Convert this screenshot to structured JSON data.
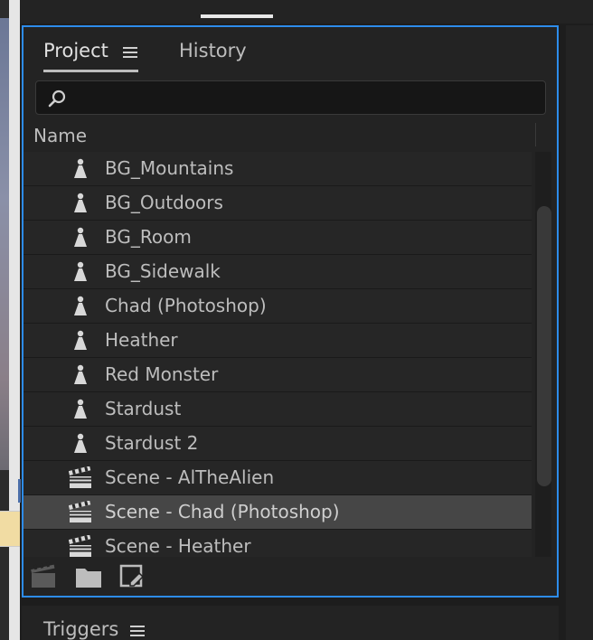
{
  "tabs": {
    "project_label": "Project",
    "history_label": "History"
  },
  "search": {
    "placeholder": "",
    "value": ""
  },
  "columns": {
    "name": "Name"
  },
  "items": [
    {
      "label": "BG_Mountains",
      "icon": "puppet-icon",
      "selected": false
    },
    {
      "label": "BG_Outdoors",
      "icon": "puppet-icon",
      "selected": false
    },
    {
      "label": "BG_Room",
      "icon": "puppet-icon",
      "selected": false
    },
    {
      "label": "BG_Sidewalk",
      "icon": "puppet-icon",
      "selected": false
    },
    {
      "label": "Chad (Photoshop)",
      "icon": "puppet-icon",
      "selected": false
    },
    {
      "label": "Heather",
      "icon": "puppet-icon",
      "selected": false
    },
    {
      "label": "Red Monster",
      "icon": "puppet-icon",
      "selected": false
    },
    {
      "label": "Stardust",
      "icon": "puppet-icon",
      "selected": false
    },
    {
      "label": "Stardust 2",
      "icon": "puppet-icon",
      "selected": false
    },
    {
      "label": "Scene - AlTheAlien",
      "icon": "clapperboard-icon",
      "selected": false
    },
    {
      "label": "Scene - Chad (Photoshop)",
      "icon": "clapperboard-icon",
      "selected": true
    },
    {
      "label": "Scene - Heather",
      "icon": "clapperboard-icon",
      "selected": false
    }
  ],
  "footer": {
    "icons": [
      "new-scene-icon",
      "new-folder-icon",
      "edit-icon"
    ]
  },
  "triggers": {
    "title": "Triggers"
  },
  "colors": {
    "panel_focus_border": "#2d8ceb",
    "panel_bg": "#232323",
    "row_bg": "#262626",
    "row_selected_bg": "#464646",
    "text": "#bdbdbd"
  }
}
